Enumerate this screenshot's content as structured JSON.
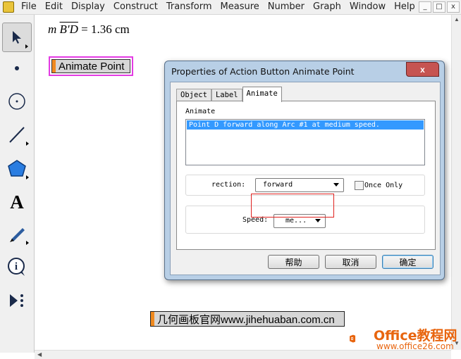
{
  "menu": [
    "File",
    "Edit",
    "Display",
    "Construct",
    "Transform",
    "Measure",
    "Number",
    "Graph",
    "Window",
    "Help"
  ],
  "window_controls": {
    "minimize": "_",
    "restore": "□",
    "close": "x"
  },
  "tools": [
    "arrow-tool",
    "point-tool",
    "compass-tool",
    "straightedge-tool",
    "polygon-tool",
    "text-tool",
    "marker-tool",
    "information-tool",
    "custom-tool"
  ],
  "canvas": {
    "measurement": {
      "prefix": "m",
      "segment": "B′D",
      "value": "= 1.36 cm"
    },
    "action_button_label": "Animate Point",
    "watermark_text": "几何画板官网www.jihehuaban.com.cn"
  },
  "dialog": {
    "title": "Properties of Action Button Animate Point",
    "close": "x",
    "tabs": [
      "Object",
      "Label",
      "Animate"
    ],
    "active_tab": "Animate",
    "animate_label": "Animate",
    "animate_item": "Point D forward along Arc #1 at medium speed.",
    "direction_label": "rection:",
    "direction_value": "forward",
    "once_only_label": "Once Only",
    "once_only_checked": false,
    "speed_label": "Speed:",
    "speed_value": "me...",
    "buttons": {
      "help": "帮助",
      "cancel": "取消",
      "ok": "确定"
    }
  },
  "branding": {
    "title": "Office教程网",
    "url": "www.office26.com",
    "accent": "#e8650f"
  }
}
